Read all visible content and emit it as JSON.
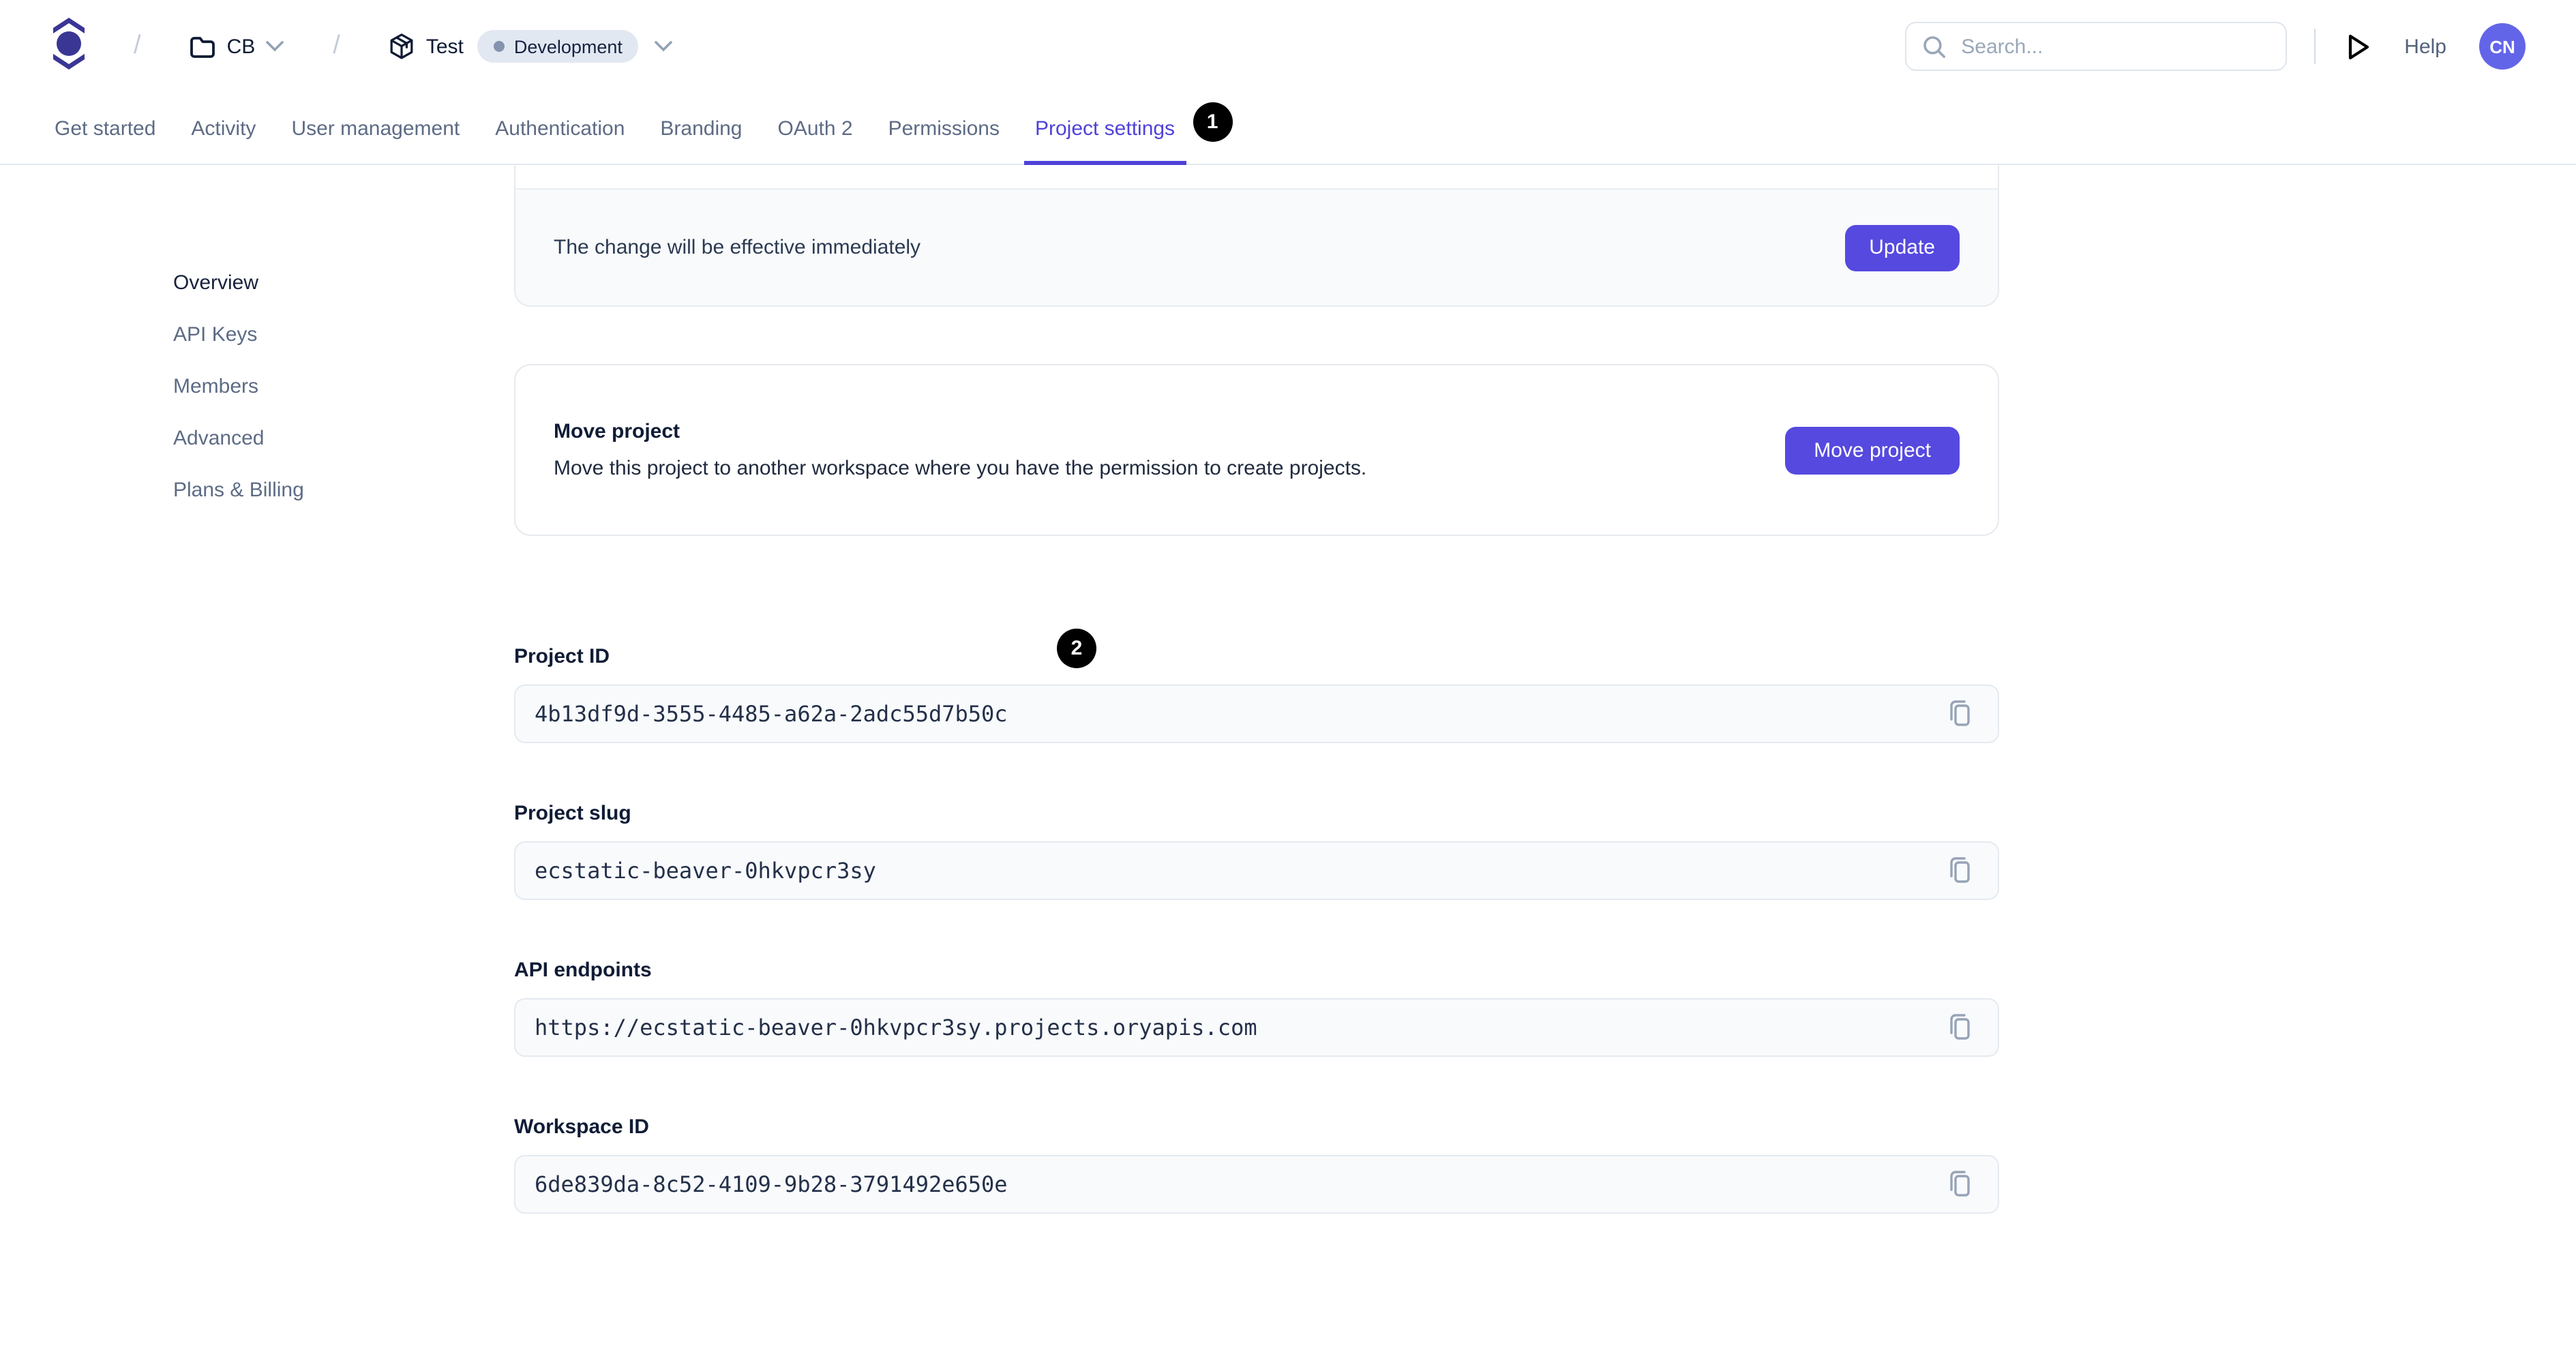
{
  "header": {
    "breadcrumb_separator": "/",
    "workspace_crumb": {
      "label": "CB"
    },
    "project_crumb": {
      "label": "Test",
      "environment_badge": "Development"
    },
    "search": {
      "placeholder": "Search..."
    },
    "help_label": "Help",
    "avatar_initials": "CN"
  },
  "tabs": {
    "items": [
      {
        "label": "Get started"
      },
      {
        "label": "Activity"
      },
      {
        "label": "User management"
      },
      {
        "label": "Authentication"
      },
      {
        "label": "Branding"
      },
      {
        "label": "OAuth 2"
      },
      {
        "label": "Permissions"
      },
      {
        "label": "Project settings"
      }
    ],
    "active_tab": "Project settings",
    "step_badge_1": "1"
  },
  "sidebar": {
    "items": [
      {
        "label": "Overview",
        "active": true
      },
      {
        "label": "API Keys"
      },
      {
        "label": "Members"
      },
      {
        "label": "Advanced"
      },
      {
        "label": "Plans & Billing"
      }
    ]
  },
  "main": {
    "update_card": {
      "note": "The change will be effective immediately",
      "button_label": "Update"
    },
    "move_card": {
      "title": "Move project",
      "description": "Move this project to another workspace where you have the permission to create projects.",
      "button_label": "Move project"
    },
    "step_badge_2": "2",
    "fields": [
      {
        "label": "Project ID",
        "value": "4b13df9d-3555-4485-a62a-2adc55d7b50c"
      },
      {
        "label": "Project slug",
        "value": "ecstatic-beaver-0hkvpcr3sy"
      },
      {
        "label": "API endpoints",
        "value": "https://ecstatic-beaver-0hkvpcr3sy.projects.oryapis.com"
      },
      {
        "label": "Workspace ID",
        "value": "6de839da-8c52-4109-9b28-3791492e650e"
      }
    ]
  },
  "colors": {
    "accent": "#5649DF",
    "active_tab": "#4F42D9",
    "logo": "#3A3694",
    "avatar_bg": "#6365E8",
    "step_badge_bg": "#000000",
    "env_badge_bg": "#E2E8F2"
  }
}
